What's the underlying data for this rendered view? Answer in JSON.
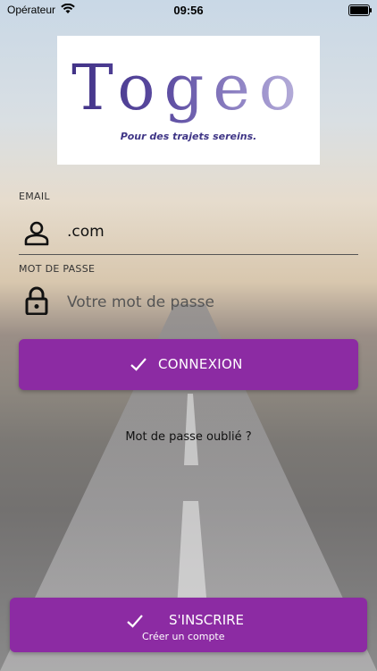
{
  "status_bar": {
    "carrier": "Opérateur",
    "time": "09:56",
    "wifi_icon": "wifi-icon",
    "battery_icon": "battery-icon"
  },
  "logo": {
    "name": "Togeo",
    "tagline": "Pour des trajets sereins."
  },
  "form": {
    "email_label": "EMAIL",
    "email_value": ".com",
    "email_icon": "user-icon",
    "password_label": "MOT DE PASSE",
    "password_placeholder": "Votre mot de passe",
    "password_icon": "lock-icon"
  },
  "actions": {
    "login_label": "CONNEXION",
    "forgot_label": "Mot de passe oublié ?",
    "signup_label": "S'INSCRIRE",
    "signup_sub": "Créer un compte"
  },
  "colors": {
    "accent": "#8c2ba3",
    "logo_primary": "#3e2f83"
  }
}
